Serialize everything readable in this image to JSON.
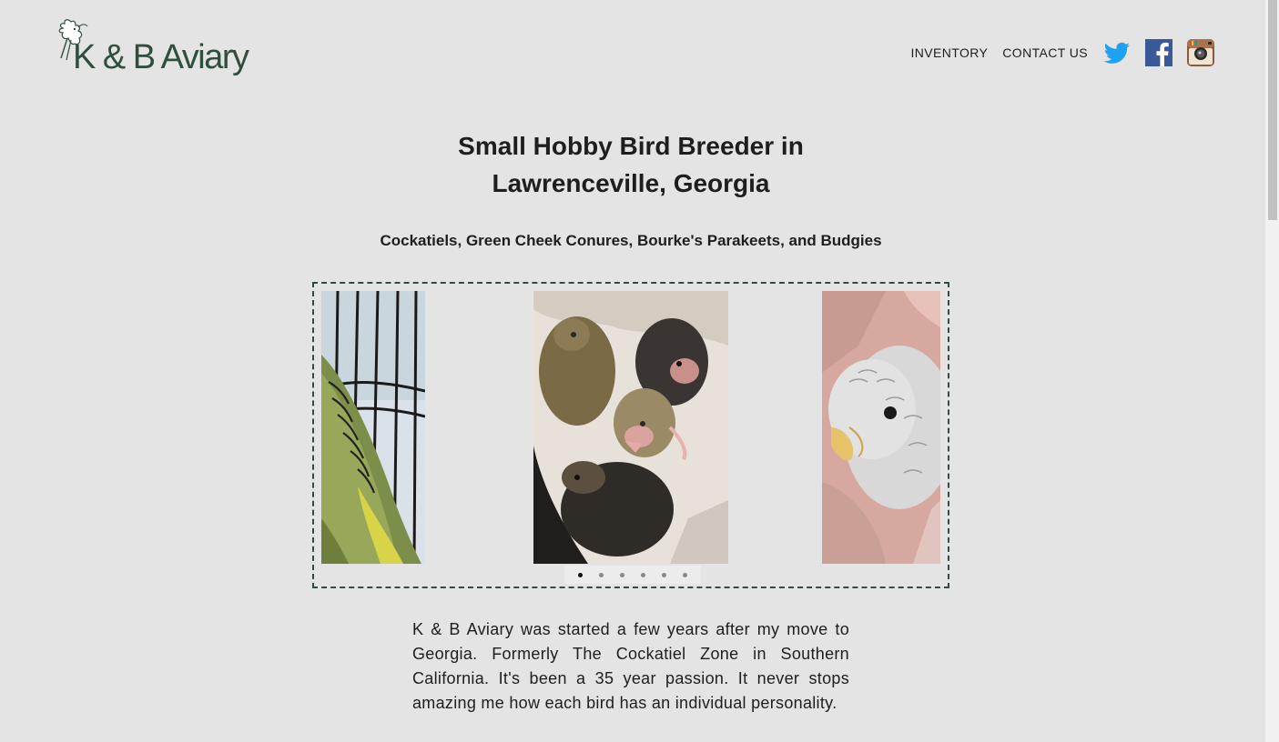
{
  "header": {
    "logo_text": "K & B Aviary",
    "logo_icon": "cockatiel-logo-icon",
    "nav": [
      {
        "label": "INVENTORY"
      },
      {
        "label": "CONTACT US"
      }
    ],
    "social": [
      {
        "icon": "twitter-icon",
        "color": "#1da1f2"
      },
      {
        "icon": "facebook-icon",
        "color": "#3b5998"
      },
      {
        "icon": "instagram-icon",
        "color": "#8a5a3c"
      }
    ]
  },
  "main": {
    "title_line1": "Small Hobby Bird Breeder in",
    "title_line2": "Lawrenceville, Georgia",
    "subtitle": "Cockatiels, Green Cheek Conures, Bourke's Parakeets, and Budgies",
    "carousel": {
      "slide_count": 6,
      "active_index": 0,
      "accent_color": "#2f4f3c"
    },
    "intro": "K & B Aviary was started a few years after my move to Georgia. Formerly The Cockatiel Zone in Southern California. It's been a 35 year passion. It never stops amazing me how each bird has an individual personality."
  }
}
